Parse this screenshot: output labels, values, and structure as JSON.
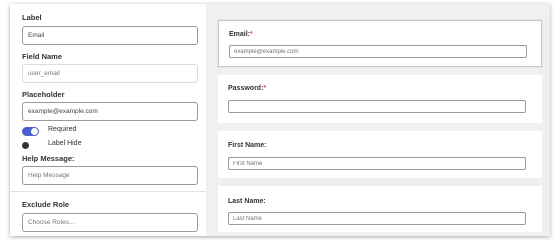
{
  "settings": {
    "label": {
      "title": "Label",
      "value": "Email"
    },
    "field_name": {
      "title": "Field Name",
      "placeholder": "user_email"
    },
    "placeholder": {
      "title": "Placeholder",
      "value": "example@example.com"
    },
    "required": {
      "label": "Required",
      "on": true
    },
    "label_hide": {
      "label": "Label Hide",
      "on": false
    },
    "help_message": {
      "title": "Help Message:",
      "placeholder": "Help Message"
    },
    "exclude_role": {
      "title": "Exclude Role",
      "placeholder": "Choose Roles..."
    }
  },
  "form": {
    "fields": [
      {
        "label": "Email:",
        "required_mark": "*",
        "placeholder": "example@example.com",
        "selected": true
      },
      {
        "label": "Password:",
        "required_mark": "*",
        "placeholder": "",
        "selected": false
      },
      {
        "label": "First Name:",
        "required_mark": "",
        "placeholder": "First Name",
        "selected": false
      },
      {
        "label": "Last Name:",
        "required_mark": "",
        "placeholder": "Last Name",
        "selected": false
      }
    ]
  },
  "colors": {
    "toggle_on": "#4a5fd0",
    "required_mark": "#e0443c",
    "preview_bg": "#f0f0f0"
  }
}
